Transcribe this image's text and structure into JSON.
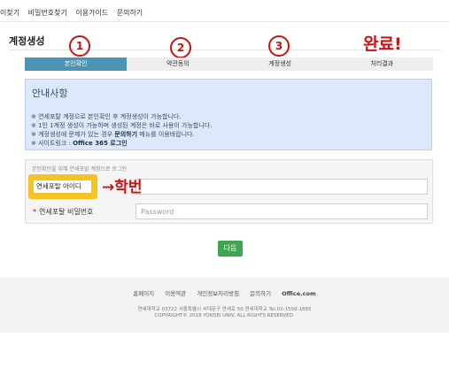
{
  "top_nav": [
    "이찾기",
    "비밀번호찾기",
    "이용가이드",
    "문의하기"
  ],
  "page_title": "계정생성",
  "steps": [
    "본인확인",
    "약관동의",
    "계정생성",
    "처리결과"
  ],
  "annotations": {
    "n1": "1",
    "n2": "2",
    "n3": "3",
    "done": "완료!",
    "arrow_label": "→학번"
  },
  "notice": {
    "title": "안내사항",
    "items": [
      "※ 연세포탈 계정으로 본인확인 후 계정생성이 가능합니다.",
      "※ 1인 1계정 생성이 가능하며 생성된 계정은 바로 사용이 가능합니다.",
      "※ 계정생성에 문제가 있는 경우 ",
      "※ 사이트링크 : "
    ],
    "item3_bold": "문의하기",
    "item3_tail": " 메뉴를 이용바랍니다.",
    "item4_bold": "Office 365 로그인"
  },
  "form": {
    "caption": "본인확인을 위해 연세포탈 계정으로 로그인",
    "id_label": "연세포탈 아이디",
    "id_value": "",
    "pw_label": "연세포탈 비밀번호",
    "pw_placeholder": "Password",
    "required_mark": "*"
  },
  "next_button": "다음",
  "footer": {
    "links": [
      "홈페이지",
      "이용약관",
      "개인정보처리방침",
      "문의하기",
      "Office.com"
    ],
    "address": "연세대학교 03722 서울특별시 서대문구 연세로 50 연세대학교 Tel.02-1599-1885",
    "copyright": "COPYRIGHT© 2018 YONSEI UNIV. ALL RIGHTS RESERVED."
  },
  "colors": {
    "step_active": "#4b94b6",
    "annotation": "#cc1111",
    "highlight": "#f7c224",
    "next_button": "#3ea650"
  }
}
